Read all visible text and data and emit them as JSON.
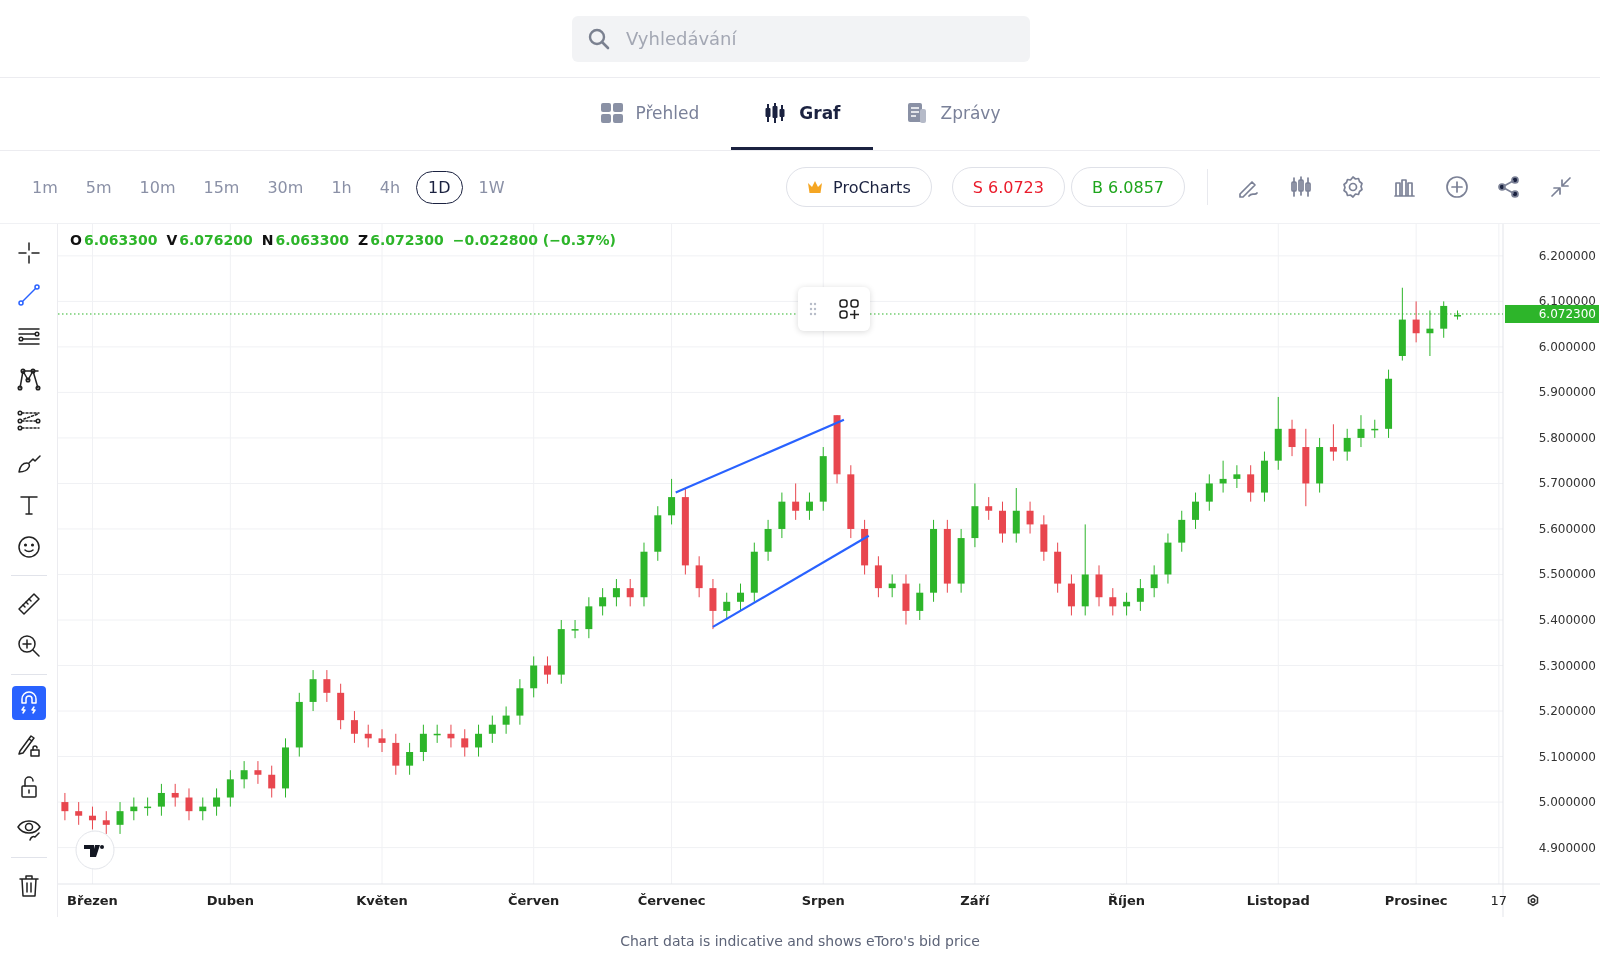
{
  "search": {
    "placeholder": "Vyhledávání"
  },
  "tabs": [
    {
      "label": "Přehled",
      "selected": false
    },
    {
      "label": "Graf",
      "selected": true
    },
    {
      "label": "Zprávy",
      "selected": false
    }
  ],
  "intervals": [
    {
      "label": "1m",
      "selected": false
    },
    {
      "label": "5m",
      "selected": false
    },
    {
      "label": "10m",
      "selected": false
    },
    {
      "label": "15m",
      "selected": false
    },
    {
      "label": "30m",
      "selected": false
    },
    {
      "label": "1h",
      "selected": false
    },
    {
      "label": "4h",
      "selected": false
    },
    {
      "label": "1D",
      "selected": true
    },
    {
      "label": "1W",
      "selected": false
    }
  ],
  "procharts_button": "ProCharts",
  "sell_button": "S 6.0723",
  "buy_button": "B 6.0857",
  "tool_groups": [
    [
      {
        "kind": "draw",
        "selected": false
      },
      {
        "kind": "draw",
        "selected": true
      },
      {
        "kind": "draw",
        "selected": false
      },
      {
        "kind": "draw",
        "selected": false
      },
      {
        "kind": "draw",
        "selected": false
      },
      {
        "kind": "draw",
        "selected": false
      },
      {
        "kind": "draw",
        "selected": false
      },
      {
        "kind": "draw",
        "selected": false
      }
    ],
    [
      {
        "kind": "draw",
        "selected": false
      },
      {
        "kind": "draw",
        "selected": false
      }
    ],
    [
      {
        "kind": "toggle",
        "selected": true
      },
      {
        "kind": "toggle",
        "selected": false
      },
      {
        "kind": "toggle",
        "selected": false
      },
      {
        "kind": "toggle",
        "selected": false
      }
    ],
    [
      {
        "kind": "action"
      }
    ]
  ],
  "legend": {
    "items": [
      {
        "label": "O",
        "value": "6.063300"
      },
      {
        "label": "V",
        "value": "6.076200"
      },
      {
        "label": "N",
        "value": "6.063300"
      },
      {
        "label": "Z",
        "value": "6.072300"
      }
    ],
    "change": "−0.022800 (−0.37%)"
  },
  "chart_data": {
    "type": "candlestick",
    "grid": true,
    "ylim": [
      4.82,
      6.27
    ],
    "yticks": [
      {
        "value": 4.9,
        "label": "4.900000"
      },
      {
        "value": 5.0,
        "label": "5.000000"
      },
      {
        "value": 5.1,
        "label": "5.100000"
      },
      {
        "value": 5.2,
        "label": "5.200000"
      },
      {
        "value": 5.3,
        "label": "5.300000"
      },
      {
        "value": 5.4,
        "label": "5.400000"
      },
      {
        "value": 5.5,
        "label": "5.500000"
      },
      {
        "value": 5.6,
        "label": "5.600000"
      },
      {
        "value": 5.7,
        "label": "5.700000"
      },
      {
        "value": 5.8,
        "label": "5.800000"
      },
      {
        "value": 5.9,
        "label": "5.900000"
      },
      {
        "value": 6.0,
        "label": "6.000000"
      },
      {
        "value": 6.1,
        "label": "6.100000"
      },
      {
        "value": 6.2,
        "label": "6.200000"
      }
    ],
    "categories": [
      null,
      null,
      "Březen",
      null,
      null,
      null,
      null,
      null,
      null,
      null,
      null,
      null,
      "Duben",
      null,
      null,
      null,
      null,
      null,
      null,
      null,
      null,
      null,
      null,
      "Květen",
      null,
      null,
      null,
      null,
      null,
      null,
      null,
      null,
      null,
      null,
      "Červen",
      null,
      null,
      null,
      null,
      null,
      null,
      null,
      null,
      null,
      "Červenec",
      null,
      null,
      null,
      null,
      null,
      null,
      null,
      null,
      null,
      null,
      "Srpen",
      null,
      null,
      null,
      null,
      null,
      null,
      null,
      null,
      null,
      null,
      "Září",
      null,
      null,
      null,
      null,
      null,
      null,
      null,
      null,
      null,
      null,
      "Říjen",
      null,
      null,
      null,
      null,
      null,
      null,
      null,
      null,
      null,
      null,
      "Listopad",
      null,
      null,
      null,
      null,
      null,
      null,
      null,
      null,
      null,
      "Prosinec",
      null,
      null,
      null,
      null,
      null,
      "17"
    ],
    "ohlc": [
      [
        5.0,
        5.02,
        4.96,
        4.98
      ],
      [
        4.98,
        5.0,
        4.95,
        4.97
      ],
      [
        4.97,
        4.99,
        4.94,
        4.96
      ],
      [
        4.96,
        4.98,
        4.93,
        4.95
      ],
      [
        4.95,
        5.0,
        4.93,
        4.98
      ],
      [
        4.98,
        5.01,
        4.96,
        4.99
      ],
      [
        4.99,
        5.01,
        4.97,
        4.99
      ],
      [
        4.99,
        5.04,
        4.97,
        5.02
      ],
      [
        5.02,
        5.04,
        4.99,
        5.01
      ],
      [
        5.01,
        5.03,
        4.96,
        4.98
      ],
      [
        4.98,
        5.01,
        4.96,
        4.99
      ],
      [
        4.99,
        5.03,
        4.97,
        5.01
      ],
      [
        5.01,
        5.07,
        4.99,
        5.05
      ],
      [
        5.05,
        5.09,
        5.03,
        5.07
      ],
      [
        5.07,
        5.09,
        5.04,
        5.06
      ],
      [
        5.06,
        5.08,
        5.01,
        5.03
      ],
      [
        5.03,
        5.14,
        5.01,
        5.12
      ],
      [
        5.12,
        5.24,
        5.1,
        5.22
      ],
      [
        5.22,
        5.29,
        5.2,
        5.27
      ],
      [
        5.27,
        5.29,
        5.22,
        5.24
      ],
      [
        5.24,
        5.26,
        5.16,
        5.18
      ],
      [
        5.18,
        5.2,
        5.13,
        5.15
      ],
      [
        5.15,
        5.17,
        5.12,
        5.14
      ],
      [
        5.14,
        5.16,
        5.11,
        5.13
      ],
      [
        5.13,
        5.15,
        5.06,
        5.08
      ],
      [
        5.08,
        5.13,
        5.06,
        5.11
      ],
      [
        5.11,
        5.17,
        5.09,
        5.15
      ],
      [
        5.15,
        5.17,
        5.13,
        5.15
      ],
      [
        5.15,
        5.17,
        5.12,
        5.14
      ],
      [
        5.14,
        5.16,
        5.1,
        5.12
      ],
      [
        5.12,
        5.17,
        5.1,
        5.15
      ],
      [
        5.15,
        5.19,
        5.13,
        5.17
      ],
      [
        5.17,
        5.21,
        5.15,
        5.19
      ],
      [
        5.19,
        5.27,
        5.17,
        5.25
      ],
      [
        5.25,
        5.32,
        5.23,
        5.3
      ],
      [
        5.3,
        5.32,
        5.26,
        5.28
      ],
      [
        5.28,
        5.4,
        5.26,
        5.38
      ],
      [
        5.38,
        5.4,
        5.36,
        5.38
      ],
      [
        5.38,
        5.45,
        5.36,
        5.43
      ],
      [
        5.43,
        5.47,
        5.41,
        5.45
      ],
      [
        5.45,
        5.49,
        5.43,
        5.47
      ],
      [
        5.47,
        5.49,
        5.43,
        5.45
      ],
      [
        5.45,
        5.57,
        5.43,
        5.55
      ],
      [
        5.55,
        5.65,
        5.53,
        5.63
      ],
      [
        5.63,
        5.71,
        5.61,
        5.67
      ],
      [
        5.67,
        5.69,
        5.5,
        5.52
      ],
      [
        5.52,
        5.54,
        5.45,
        5.47
      ],
      [
        5.47,
        5.49,
        5.38,
        5.42
      ],
      [
        5.42,
        5.46,
        5.4,
        5.44
      ],
      [
        5.44,
        5.48,
        5.42,
        5.46
      ],
      [
        5.46,
        5.57,
        5.44,
        5.55
      ],
      [
        5.55,
        5.62,
        5.53,
        5.6
      ],
      [
        5.6,
        5.68,
        5.58,
        5.66
      ],
      [
        5.66,
        5.7,
        5.62,
        5.64
      ],
      [
        5.64,
        5.68,
        5.62,
        5.66
      ],
      [
        5.66,
        5.78,
        5.64,
        5.76
      ],
      [
        5.85,
        5.85,
        5.7,
        5.72
      ],
      [
        5.72,
        5.74,
        5.58,
        5.6
      ],
      [
        5.6,
        5.62,
        5.5,
        5.52
      ],
      [
        5.52,
        5.54,
        5.45,
        5.47
      ],
      [
        5.47,
        5.5,
        5.45,
        5.48
      ],
      [
        5.48,
        5.5,
        5.39,
        5.42
      ],
      [
        5.42,
        5.48,
        5.4,
        5.46
      ],
      [
        5.46,
        5.62,
        5.44,
        5.6
      ],
      [
        5.6,
        5.62,
        5.46,
        5.48
      ],
      [
        5.48,
        5.6,
        5.46,
        5.58
      ],
      [
        5.58,
        5.7,
        5.56,
        5.65
      ],
      [
        5.65,
        5.67,
        5.62,
        5.64
      ],
      [
        5.64,
        5.66,
        5.57,
        5.59
      ],
      [
        5.59,
        5.69,
        5.57,
        5.64
      ],
      [
        5.64,
        5.66,
        5.59,
        5.61
      ],
      [
        5.61,
        5.63,
        5.53,
        5.55
      ],
      [
        5.55,
        5.57,
        5.46,
        5.48
      ],
      [
        5.48,
        5.5,
        5.41,
        5.43
      ],
      [
        5.43,
        5.61,
        5.41,
        5.5
      ],
      [
        5.5,
        5.52,
        5.43,
        5.45
      ],
      [
        5.45,
        5.47,
        5.41,
        5.43
      ],
      [
        5.43,
        5.46,
        5.41,
        5.44
      ],
      [
        5.44,
        5.49,
        5.42,
        5.47
      ],
      [
        5.47,
        5.52,
        5.45,
        5.5
      ],
      [
        5.5,
        5.59,
        5.48,
        5.57
      ],
      [
        5.57,
        5.64,
        5.55,
        5.62
      ],
      [
        5.62,
        5.68,
        5.6,
        5.66
      ],
      [
        5.66,
        5.72,
        5.64,
        5.7
      ],
      [
        5.7,
        5.75,
        5.68,
        5.71
      ],
      [
        5.71,
        5.74,
        5.69,
        5.72
      ],
      [
        5.72,
        5.74,
        5.66,
        5.68
      ],
      [
        5.68,
        5.77,
        5.66,
        5.75
      ],
      [
        5.75,
        5.89,
        5.73,
        5.82
      ],
      [
        5.82,
        5.84,
        5.76,
        5.78
      ],
      [
        5.78,
        5.82,
        5.65,
        5.7
      ],
      [
        5.7,
        5.8,
        5.68,
        5.78
      ],
      [
        5.78,
        5.83,
        5.75,
        5.77
      ],
      [
        5.77,
        5.82,
        5.75,
        5.8
      ],
      [
        5.8,
        5.85,
        5.78,
        5.82
      ],
      [
        5.82,
        5.84,
        5.8,
        5.82
      ],
      [
        5.82,
        5.95,
        5.8,
        5.93
      ],
      [
        5.98,
        6.13,
        5.97,
        6.06
      ],
      [
        6.06,
        6.1,
        6.01,
        6.03
      ],
      [
        6.03,
        6.08,
        5.98,
        6.04
      ],
      [
        6.04,
        6.1,
        6.02,
        6.09
      ],
      [
        6.07,
        6.08,
        6.06,
        6.07
      ],
      null,
      null,
      null
    ]
  },
  "current_price": "6.072300",
  "footer": "Chart data is indicative and shows eToro's bid price"
}
